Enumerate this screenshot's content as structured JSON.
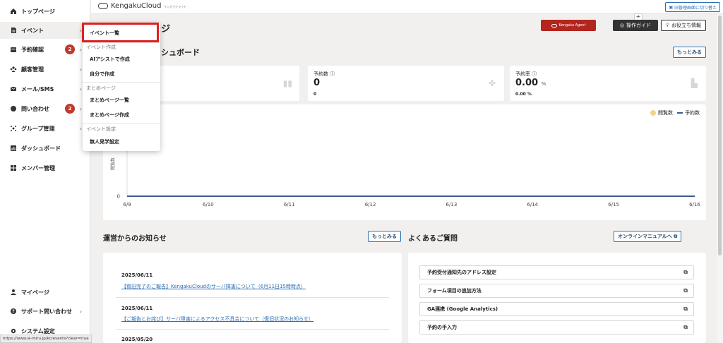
{
  "sidebar": {
    "items": [
      {
        "label": "トップページ",
        "icon": "home-icon"
      },
      {
        "label": "イベント",
        "icon": "document-icon"
      },
      {
        "label": "予約確認",
        "icon": "calendar-icon",
        "badge": "2"
      },
      {
        "label": "顧客管理",
        "icon": "users-icon"
      },
      {
        "label": "メール/SMS",
        "icon": "mail-icon"
      },
      {
        "label": "問い合わせ",
        "icon": "chat-icon",
        "badge": "2"
      },
      {
        "label": "グループ管理",
        "icon": "group-icon"
      },
      {
        "label": "ダッシュボード",
        "icon": "dashboard-icon"
      },
      {
        "label": "メンバー管理",
        "icon": "grid-icon"
      }
    ],
    "bottom": [
      {
        "label": "マイページ",
        "icon": "person-icon"
      },
      {
        "label": "サポート問い合わせ",
        "icon": "help-icon"
      },
      {
        "label": "システム設定",
        "icon": "gear-icon"
      }
    ]
  },
  "header": {
    "logo_text": "KengakuCloud",
    "logo_sub": "ケンガククラウド",
    "switch_label": "旧管理画面に切り替え"
  },
  "topbar": {
    "title_fragment": "ジ",
    "agent_label": "Kengaku Agent",
    "guide_label": "操作ガイド",
    "guide_plus": "+",
    "tips_label": "お役立ち情報"
  },
  "dashboard": {
    "title_fragment": "シュボード",
    "more_label": "もっとみる",
    "stats": [
      {
        "label": "予約数 ⓘ",
        "value": "0",
        "unit": "",
        "sub": "0"
      },
      {
        "label": "予約率 ⓘ",
        "value": "0.00",
        "unit": "%",
        "sub": "0.00 %"
      }
    ],
    "legend": {
      "views": "閲覧数",
      "reservations": "予約数"
    }
  },
  "chart_data": {
    "type": "line",
    "x": [
      "6/9",
      "6/10",
      "6/11",
      "6/12",
      "6/13",
      "6/14",
      "6/15",
      "6/16"
    ],
    "series": [
      {
        "name": "閲覧数",
        "values": [
          0,
          0,
          0,
          0,
          0,
          0,
          0,
          0
        ],
        "color": "#f1d48c"
      },
      {
        "name": "予約数",
        "values": [
          0,
          0,
          0,
          0,
          0,
          0,
          0,
          0
        ],
        "color": "#3d5a8c"
      }
    ],
    "ylabel": "閲覧数",
    "yticks": [
      "0"
    ],
    "ylim": [
      0,
      1
    ],
    "legend": "top-right"
  },
  "news": {
    "title": "運営からのお知らせ",
    "more_label": "もっとみる",
    "items": [
      {
        "date": "2025/06/11",
        "text": "【復旧完了のご報告】KengakuCloudのサーバ障害について（6月11日15時時点）"
      },
      {
        "date": "2025/06/11",
        "text": "【ご報告とお詫び】サーバ障害によるアクセス不具合について（復旧状況のお知らせ）"
      },
      {
        "date": "2025/05/20",
        "text": ""
      }
    ]
  },
  "faq": {
    "title": "よくあるご質問",
    "manual_label": "オンラインマニュアルへ ⧉",
    "items": [
      "予約受付通知先のアドレス設定",
      "フォーム項目の追加方法",
      "GA連携 (Google Analytics)",
      "予約の手入力"
    ]
  },
  "dropdown": {
    "items": [
      {
        "type": "item",
        "label": "イベント一覧"
      },
      {
        "type": "group",
        "label": "イベント作成"
      },
      {
        "type": "item",
        "label": "AIアシストで作成"
      },
      {
        "type": "item",
        "label": "自分で作成"
      },
      {
        "type": "group",
        "label": "まとめページ"
      },
      {
        "type": "item",
        "label": "まとめページ一覧"
      },
      {
        "type": "item",
        "label": "まとめページ作成"
      },
      {
        "type": "group",
        "label": "イベント設定"
      },
      {
        "type": "item",
        "label": "無人見学設定"
      }
    ]
  },
  "status_url": "https://www.ie-miru.jp/kc/events?clear=true",
  "colors": {
    "accent": "#2d6fb5",
    "agent": "#b3261e",
    "badge": "#c0392b",
    "highlight": "#e02020"
  }
}
